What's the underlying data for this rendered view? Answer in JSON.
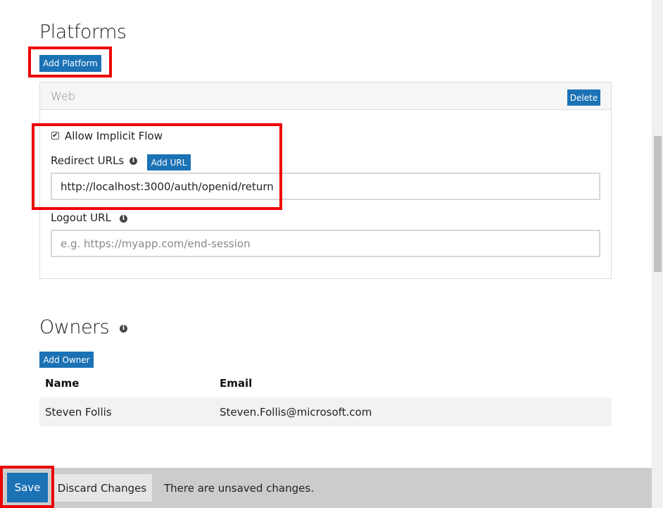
{
  "platforms": {
    "heading": "Platforms",
    "add_button": "Add Platform",
    "web": {
      "title": "Web",
      "delete_button": "Delete",
      "allow_implicit_flow_label": "Allow Implicit Flow",
      "allow_implicit_flow_checked": true,
      "redirect_urls_label": "Redirect URLs",
      "add_url_button": "Add URL",
      "redirect_url_value": "http://localhost:3000/auth/openid/return",
      "logout_url_label": "Logout URL",
      "logout_url_placeholder": "e.g. https://myapp.com/end-session"
    }
  },
  "owners": {
    "heading": "Owners",
    "add_button": "Add Owner",
    "columns": [
      "Name",
      "Email"
    ],
    "rows": [
      {
        "name": "Steven Follis",
        "email": "Steven.Follis@microsoft.com"
      }
    ]
  },
  "footer": {
    "save_label": "Save",
    "discard_label": "Discard Changes",
    "status_text": "There are unsaved changes."
  },
  "icons": {
    "info": "info-icon",
    "checkbox_mark": "✔"
  },
  "colors": {
    "accent": "#1b72b5",
    "highlight": "#ee0000"
  }
}
